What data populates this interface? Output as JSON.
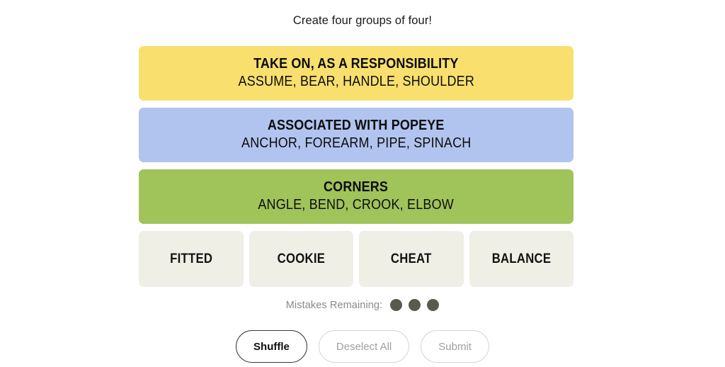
{
  "instruction": "Create four groups of four!",
  "colors": {
    "yellow": "#f9df6d",
    "blue": "#b0c4ef",
    "green": "#a0c35a",
    "tile": "#efefe6",
    "dot": "#5a594e",
    "muted_text": "#8a8a8a"
  },
  "solved_groups": [
    {
      "title": "TAKE ON, AS A RESPONSIBILITY",
      "members": "ASSUME, BEAR, HANDLE, SHOULDER",
      "color_name": "yellow",
      "color": "#f9df6d"
    },
    {
      "title": "ASSOCIATED WITH POPEYE",
      "members": "ANCHOR, FOREARM, PIPE, SPINACH",
      "color_name": "blue",
      "color": "#b0c4ef"
    },
    {
      "title": "CORNERS",
      "members": "ANGLE, BEND, CROOK, ELBOW",
      "color_name": "green",
      "color": "#a0c35a"
    }
  ],
  "remaining_tiles": [
    {
      "label": "FITTED"
    },
    {
      "label": "COOKIE"
    },
    {
      "label": "CHEAT"
    },
    {
      "label": "BALANCE"
    }
  ],
  "mistakes": {
    "label": "Mistakes Remaining:",
    "remaining": 3,
    "dots": [
      1,
      2,
      3
    ]
  },
  "controls": {
    "shuffle": {
      "label": "Shuffle",
      "enabled": true
    },
    "deselect_all": {
      "label": "Deselect All",
      "enabled": false
    },
    "submit": {
      "label": "Submit",
      "enabled": false
    }
  }
}
